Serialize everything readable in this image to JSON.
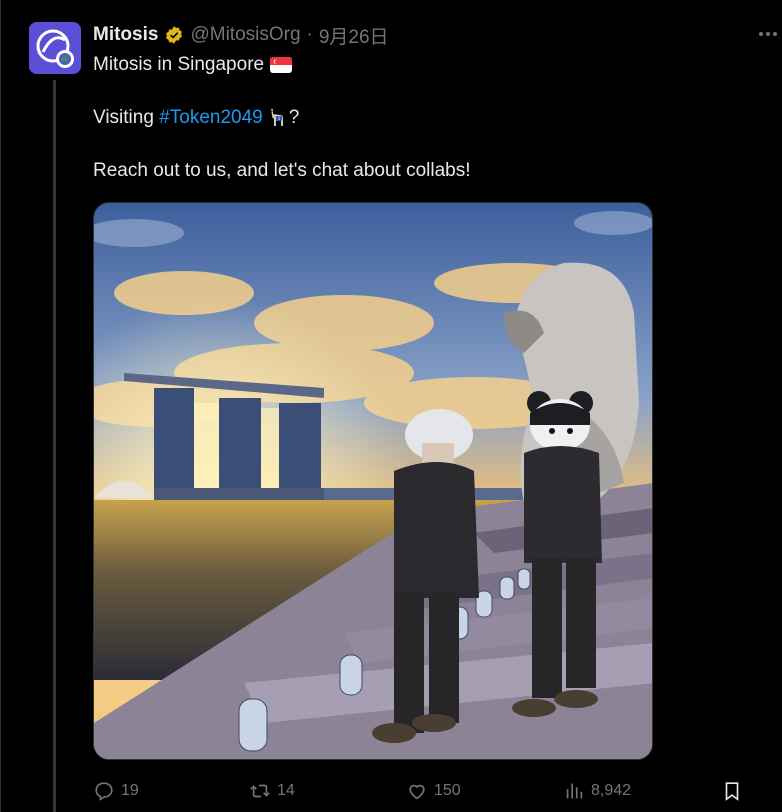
{
  "tweet": {
    "author_name": "Mitosis",
    "handle": "@MitosisOrg",
    "separator": "·",
    "time": "9月26日",
    "line1": "Mitosis in Singapore",
    "line2_prefix": "Visiting ",
    "hashtag": "#Token2049",
    "line2_suffix": "?",
    "line3": "Reach out to us, and let's chat about collabs!"
  },
  "actions": {
    "replies": "19",
    "retweets": "14",
    "likes": "150",
    "views": "8,942"
  },
  "icons": {
    "verified": "verified-badge-icon",
    "flag": "singapore-flag-icon",
    "more": "more-options-icon",
    "reply": "reply-icon",
    "retweet": "retweet-icon",
    "like": "heart-icon",
    "views": "views-bar-chart-icon",
    "bookmark": "bookmark-icon"
  },
  "colors": {
    "background": "#000000",
    "text": "#e7e9ea",
    "muted": "#71767b",
    "link": "#1d9bf0",
    "verified": "#e2b719",
    "avatar": "#5a4fd6"
  }
}
